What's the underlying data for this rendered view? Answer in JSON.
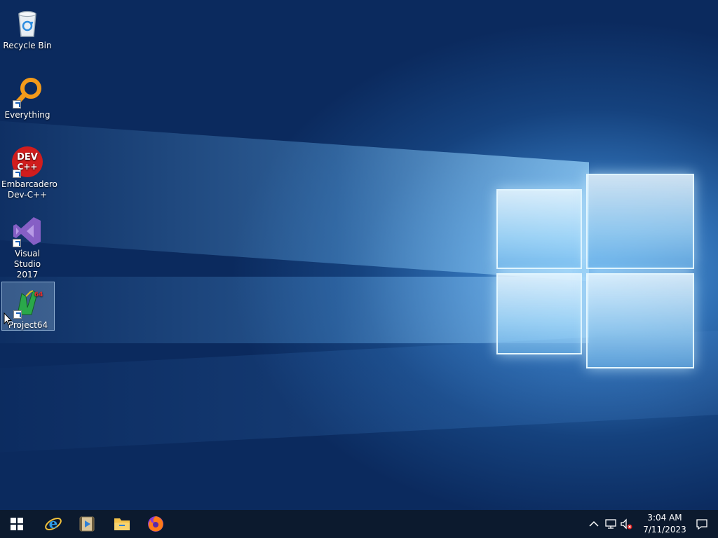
{
  "desktop": {
    "icons": [
      {
        "label": "Recycle Bin",
        "icon": "recycle-bin-icon"
      },
      {
        "label": "Everything",
        "icon": "everything-search-icon"
      },
      {
        "label_line1": "Embarcadero",
        "label_line2": "Dev-C++",
        "icon": "dev-cpp-icon",
        "glyph_text_1": "DEV",
        "glyph_text_2": "C++"
      },
      {
        "label_line1": "Visual Studio",
        "label_line2": "2017",
        "icon": "visual-studio-icon"
      },
      {
        "label": "Project64",
        "icon": "project64-icon",
        "glyph_text": "64"
      }
    ]
  },
  "taskbar": {
    "pinned": [
      {
        "name": "start",
        "icon": "windows-start-icon"
      },
      {
        "name": "internet-explorer",
        "icon": "internet-explorer-icon"
      },
      {
        "name": "windows-media-player",
        "icon": "media-player-icon"
      },
      {
        "name": "file-explorer",
        "icon": "folder-icon"
      },
      {
        "name": "firefox",
        "icon": "firefox-icon"
      }
    ],
    "tray": {
      "time": "3:04 AM",
      "date": "7/11/2023"
    }
  },
  "colors": {
    "taskbar_bg": "#0c1a2e",
    "desktop_dark": "#0b2a5e",
    "desktop_light": "#5aa6e6"
  }
}
